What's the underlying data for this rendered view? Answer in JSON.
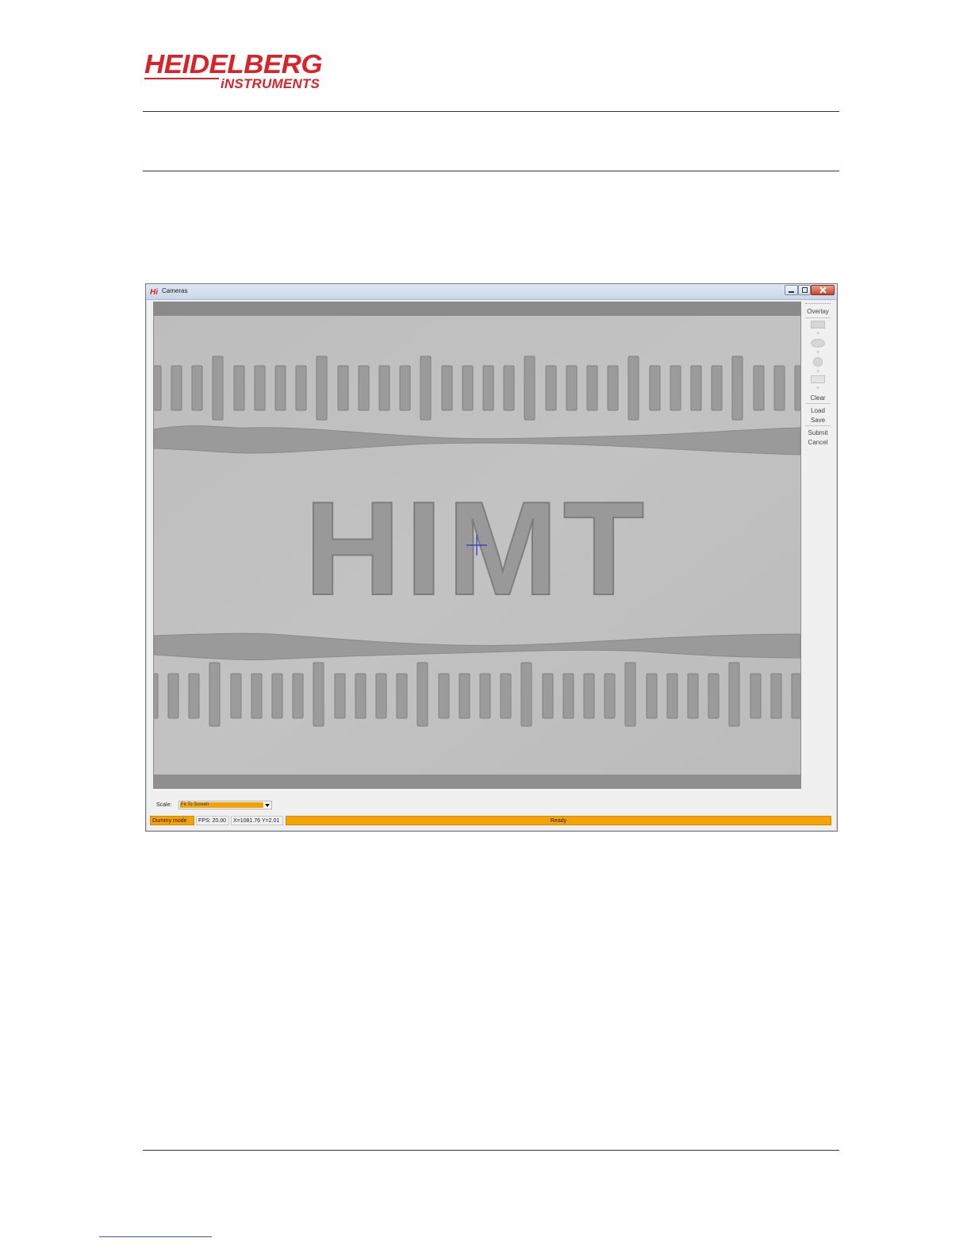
{
  "brand": {
    "logo_top": "HEIDELBERG",
    "logo_bottom": "iNSTRUMENTS",
    "accent_color": "#d8232a"
  },
  "window": {
    "title": "Cameras",
    "app_icon": "hi-app-icon",
    "controls": [
      "minimize-icon",
      "maximize-icon",
      "close-icon"
    ]
  },
  "camera_view": {
    "overlay_text": "HIMT",
    "crosshair_color": "#2a2ad8"
  },
  "sidebar": {
    "overlay_label": "Overlay",
    "tools": [
      "rectangle-tool-icon",
      "ellipse-tool-icon",
      "circle-tool-icon",
      "ruler-tool-icon"
    ],
    "clear_label": "Clear",
    "load_label": "Load",
    "save_label": "Save",
    "submit_label": "Submit",
    "cancel_label": "Cancel"
  },
  "scale": {
    "label": "Scale:",
    "value": "Fit To Screen"
  },
  "status": {
    "mode": "Dummy mode",
    "fps": "FPS: 20.00",
    "coords": "X=1081.76 Y=2.01",
    "state": "Ready",
    "accent_color": "#f5a20a"
  }
}
